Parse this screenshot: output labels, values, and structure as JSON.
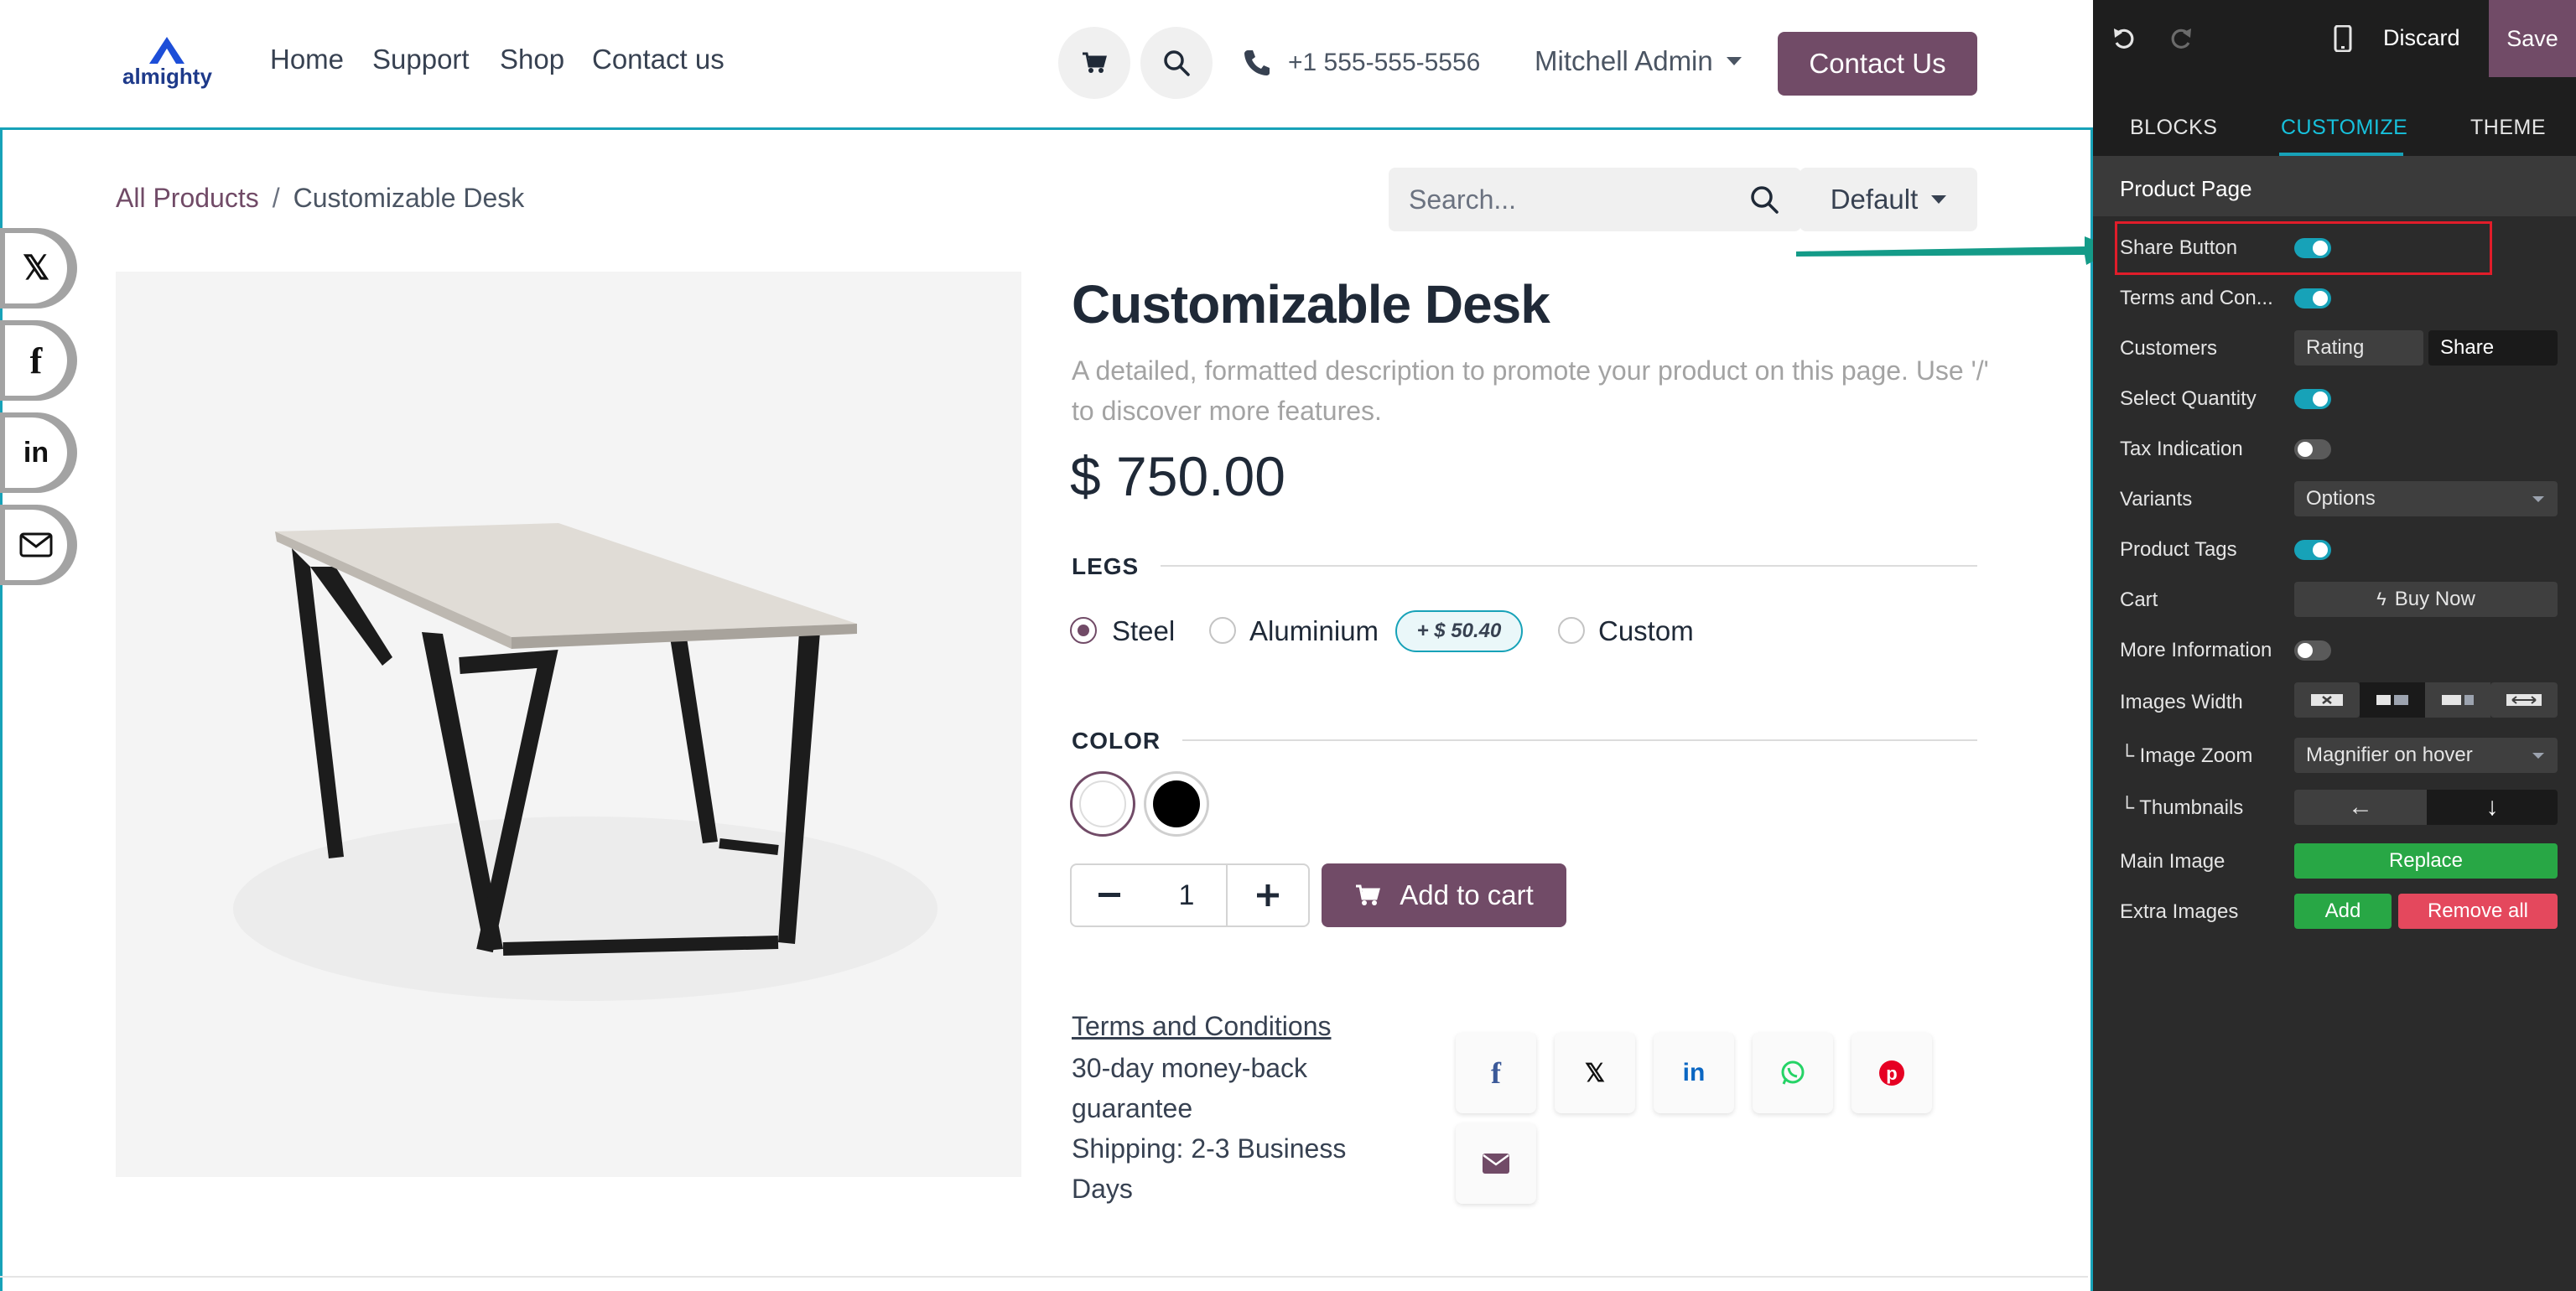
{
  "site": {
    "logo_text": "almighty",
    "nav": [
      "Home",
      "Support",
      "Shop",
      "Contact us"
    ],
    "phone": "+1 555-555-5556",
    "user": "Mitchell Admin",
    "contact_button": "Contact Us"
  },
  "breadcrumb": {
    "parent": "All Products",
    "separator": "/",
    "current": "Customizable Desk"
  },
  "search": {
    "placeholder": "Search..."
  },
  "sort": {
    "label": "Default"
  },
  "product": {
    "name": "Customizable Desk",
    "description": "A detailed, formatted description to promote your product on this page. Use '/' to discover more features.",
    "price": "$ 750.00",
    "legs_label": "LEGS",
    "legs_options": [
      "Steel",
      "Aluminium",
      "Custom"
    ],
    "legs_selected": "Steel",
    "aluminium_extra": "+ $ 50.40",
    "color_label": "COLOR",
    "colors": [
      "#ffffff",
      "#000000"
    ],
    "quantity": "1",
    "add_to_cart": "Add to cart",
    "terms_link": "Terms and Conditions",
    "guarantee": "30-day money-back guarantee",
    "shipping": "Shipping: 2-3 Business Days"
  },
  "social_rail": [
    "x-icon",
    "facebook-icon",
    "linkedin-icon",
    "envelope-icon"
  ],
  "share_buttons": [
    "facebook-icon",
    "x-icon",
    "linkedin-icon",
    "whatsapp-icon",
    "pinterest-icon",
    "envelope-icon"
  ],
  "colors": {
    "brand": "#714b67",
    "accent": "#17a2b8",
    "editor_bg": "#2b2b2b",
    "green": "#28a745",
    "red": "#e4485d",
    "annotation": "#e11d2a",
    "arrow": "#149b88"
  },
  "editor": {
    "discard": "Discard",
    "save": "Save",
    "tabs": [
      "BLOCKS",
      "CUSTOMIZE",
      "THEME"
    ],
    "active_tab": "CUSTOMIZE",
    "section_title": "Product Page",
    "options": {
      "share_button": {
        "label": "Share Button",
        "enabled": true
      },
      "terms": {
        "label": "Terms and Con...",
        "enabled": true
      },
      "customers": {
        "label": "Customers",
        "rating": "Rating",
        "share": "Share"
      },
      "select_quantity": {
        "label": "Select Quantity",
        "enabled": true
      },
      "tax_indication": {
        "label": "Tax Indication",
        "enabled": false
      },
      "variants": {
        "label": "Variants",
        "value": "Options"
      },
      "product_tags": {
        "label": "Product Tags",
        "enabled": true
      },
      "cart": {
        "label": "Cart",
        "value": "Buy Now"
      },
      "more_info": {
        "label": "More Information",
        "enabled": false
      },
      "images_width": {
        "label": "Images Width"
      },
      "image_zoom": {
        "label": "└ Image Zoom",
        "value": "Magnifier on hover"
      },
      "thumbnails": {
        "label": "└ Thumbnails",
        "left": "←",
        "down": "↓"
      },
      "main_image": {
        "label": "Main Image",
        "button": "Replace"
      },
      "extra_images": {
        "label": "Extra Images",
        "add": "Add",
        "remove_all": "Remove all"
      }
    }
  }
}
